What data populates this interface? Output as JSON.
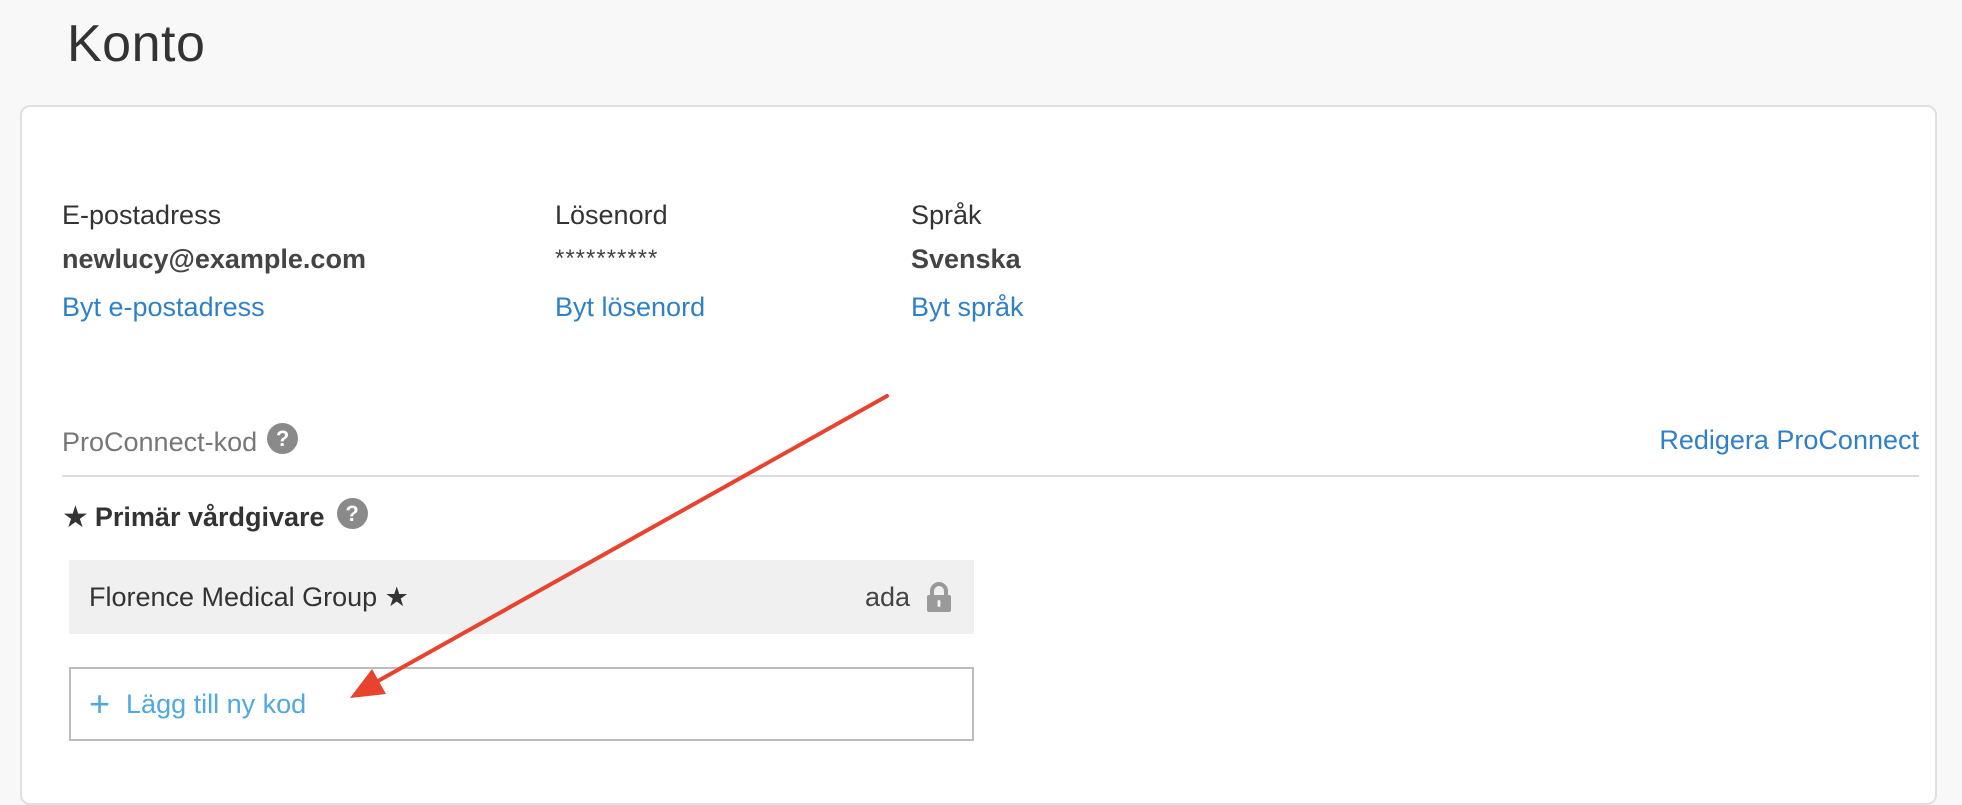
{
  "page": {
    "title": "Konto"
  },
  "account": {
    "email": {
      "label": "E-postadress",
      "value": "newlucy@example.com",
      "link": "Byt e-postadress"
    },
    "password": {
      "label": "Lösenord",
      "value": "**********",
      "link": "Byt lösenord"
    },
    "language": {
      "label": "Språk",
      "value": "Svenska",
      "link": "Byt språk"
    }
  },
  "proconnect": {
    "section_title": "ProConnect-kod",
    "help_icon": "help-circle-icon",
    "edit_link": "Redigera ProConnect",
    "primary_heading": "Primär vårdgivare",
    "primary_star": "★",
    "providers": [
      {
        "name": "Florence Medical Group ★",
        "code": "ada",
        "icon": "lock-icon"
      }
    ],
    "add_button": {
      "icon": "+",
      "label": "Lägg till ny kod"
    }
  },
  "colors": {
    "link": "#3080c8",
    "add_link": "#4fa8e0",
    "annotation_arrow": "#e8432e"
  }
}
